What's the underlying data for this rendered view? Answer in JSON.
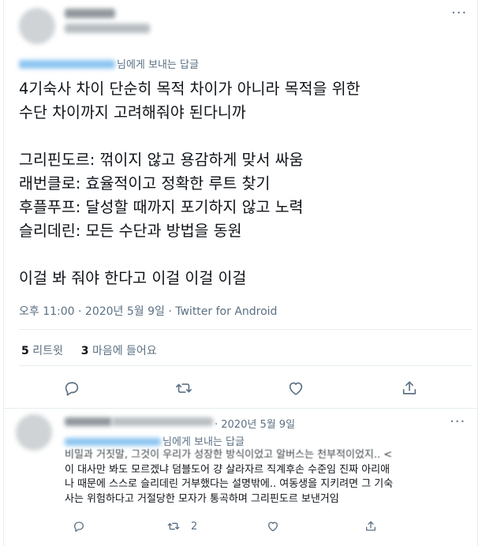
{
  "main_tweet": {
    "reply_to_suffix": "님에게 보내는 답글",
    "text_lines": [
      "4기숙사 차이 단순히 목적 차이가 아니라 목적을 위한",
      "수단 차이까지 고려해줘야 된다니까",
      "",
      "그리핀도르: 꺾이지 않고 용감하게 맞서 싸움",
      "래번클로: 효율적이고 정확한 루트 찾기",
      "후플푸프: 달성할 때까지 포기하지 않고 노력",
      "슬리데린: 모든 수단과 방법을 동원",
      "",
      "이걸 봐 줘야 한다고 이걸 이걸 이걸"
    ],
    "timestamp": "오후 11:00 · 2020년 5월 9일 · Twitter for Android",
    "retweet_count": "5",
    "retweet_label": "리트윗",
    "like_count": "3",
    "like_label": "마음에 들어요"
  },
  "reply_tweet": {
    "date": "· 2020년 5월 9일",
    "reply_to_suffix": "님에게 보내는 답글",
    "text_lines": [
      "비밀과 거짓말, 그것이 우리가 성장한 방식이었고 알버스는 천부적이었지.. <",
      "이 대사만 봐도 모르겠냐 덤블도어 걍 살라자르 직계후손 수준임 진짜 아리애",
      "나 때문에 스스로 슬리데린 거부했다는 설명밖에.. 여동생을 지키려면 그 기숙",
      "사는 위험하다고 거절당한 모자가 통곡하며 그리핀도르 보낸거임"
    ],
    "retweet_count": "2"
  },
  "icons": {
    "more": "more-icon",
    "reply": "reply-icon",
    "retweet": "retweet-icon",
    "like": "heart-icon",
    "share": "share-icon"
  },
  "colors": {
    "text": "#0f1419",
    "secondary": "#5b7083",
    "divider": "#e6ecf0",
    "mention": "#1da1f2"
  }
}
